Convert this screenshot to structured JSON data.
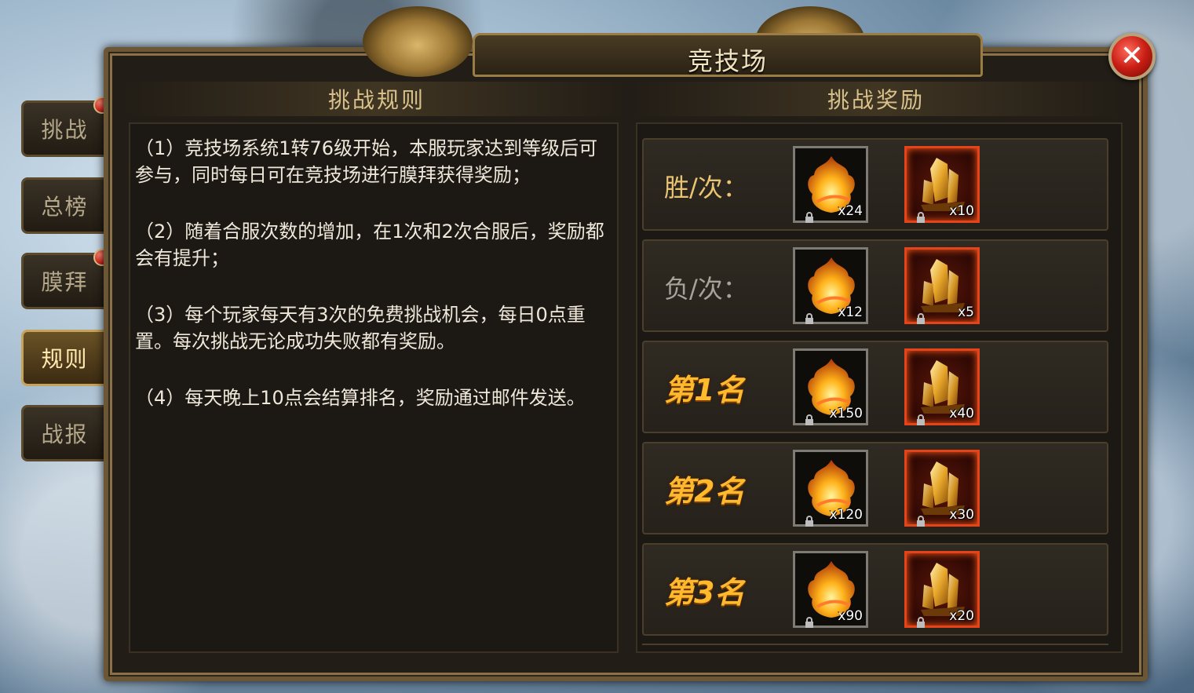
{
  "window": {
    "title": "竞技场"
  },
  "close": {
    "label": "✕"
  },
  "tabs": [
    {
      "label": "挑战",
      "badge": true,
      "active": false
    },
    {
      "label": "总榜",
      "badge": false,
      "active": false
    },
    {
      "label": "膜拜",
      "badge": true,
      "active": false
    },
    {
      "label": "规则",
      "badge": false,
      "active": true
    },
    {
      "label": "战报",
      "badge": false,
      "active": false
    }
  ],
  "rules": {
    "header": "挑战规则",
    "items": [
      "（1）竞技场系统1转76级开始，本服玩家达到等级后可参与，同时每日可在竞技场进行膜拜获得奖励；",
      "（2）随着合服次数的增加，在1次和2次合服后，奖励都会有提升；",
      "（3）每个玩家每天有3次的免费挑战机会，每日0点重置。每次挑战无论成功失败都有奖励。",
      "（4）每天晚上10点会结算排名，奖励通过邮件发送。"
    ]
  },
  "rewards": {
    "header": "挑战奖励",
    "rows": [
      {
        "label": "胜/次：",
        "kind": "win",
        "item_a": "x24",
        "item_b": "x10"
      },
      {
        "label": "负/次：",
        "kind": "lose",
        "item_a": "x12",
        "item_b": "x5"
      },
      {
        "label": "第1名",
        "kind": "rank",
        "item_a": "x150",
        "item_b": "x40"
      },
      {
        "label": "第2名",
        "kind": "rank",
        "item_a": "x120",
        "item_b": "x30"
      },
      {
        "label": "第3名",
        "kind": "rank",
        "item_a": "x90",
        "item_b": "x20"
      }
    ],
    "icons": {
      "item_a": "flame-leaf-icon",
      "item_b": "gold-crystal-icon",
      "lock": "lock-icon"
    }
  },
  "colors": {
    "accent_gold": "#d8c18a",
    "rank_orange": "#ffb92e",
    "badge_red": "#d8261a"
  }
}
